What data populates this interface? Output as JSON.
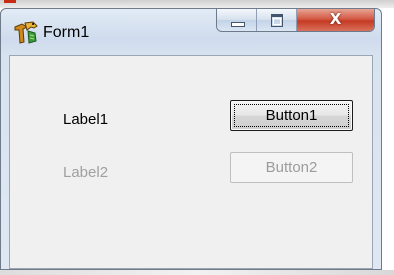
{
  "window": {
    "title": "Form1",
    "icon": "lazarus-cheetah-icon",
    "controls": {
      "minimize": "minimize-icon",
      "maximize": "maximize-icon",
      "close": "X"
    }
  },
  "form": {
    "label1": "Label1",
    "label2": "Label2",
    "button1": "Button1",
    "button2": "Button2"
  },
  "colors": {
    "close_button": "#c53a24",
    "disabled_text": "#a0a0a0",
    "titlebar": "#cfdced"
  }
}
